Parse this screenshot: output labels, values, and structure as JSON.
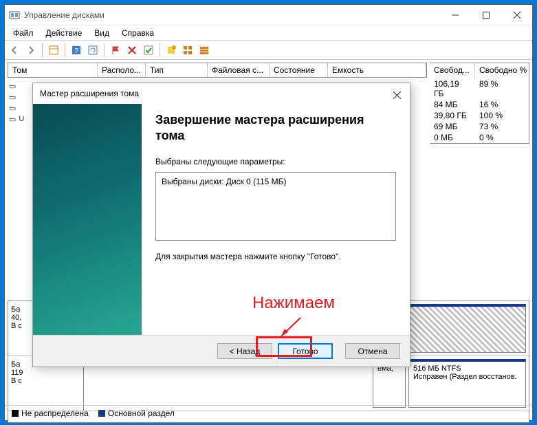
{
  "window": {
    "title": "Управление дисками"
  },
  "menu": {
    "file": "Файл",
    "action": "Действие",
    "view": "Вид",
    "help": "Справка"
  },
  "columns": {
    "tom": "Том",
    "layout": "Располо...",
    "type": "Тип",
    "fs": "Файловая с...",
    "status": "Состояние",
    "capacity": "Емкость",
    "free": "Свобод...",
    "freepct": "Свободно %"
  },
  "rows": [
    {
      "free": "106,19 ГБ",
      "pct": "89 %"
    },
    {
      "free": "84 МБ",
      "pct": "16 %"
    },
    {
      "free": "39,80 ГБ",
      "pct": "100 %"
    },
    {
      "free": "69 МБ",
      "pct": "73 %"
    },
    {
      "free": "0 МБ",
      "pct": "0 %"
    }
  ],
  "disk1": {
    "label0": "Ба",
    "label1": "40,",
    "label2": "В с"
  },
  "disk2": {
    "label0": "Ба",
    "label1": "119",
    "label2": "В с",
    "part_ema": "ема,",
    "part_info0": "516 МБ NTFS",
    "part_info1": "Исправен (Раздел восстанов."
  },
  "legend": {
    "unalloc": "Не распределена",
    "primary": "Основной раздел"
  },
  "wizard": {
    "title": "Мастер расширения тома",
    "heading": "Завершение мастера расширения тома",
    "params_label": "Выбраны следующие параметры:",
    "params_value": "Выбраны диски: Диск 0 (115 МБ)",
    "finish_hint": "Для закрытия мастера нажмите кнопку \"Готово\".",
    "back": "< Назад",
    "finish": "Готово",
    "cancel": "Отмена"
  },
  "annotation": {
    "text": "Нажимаем"
  }
}
